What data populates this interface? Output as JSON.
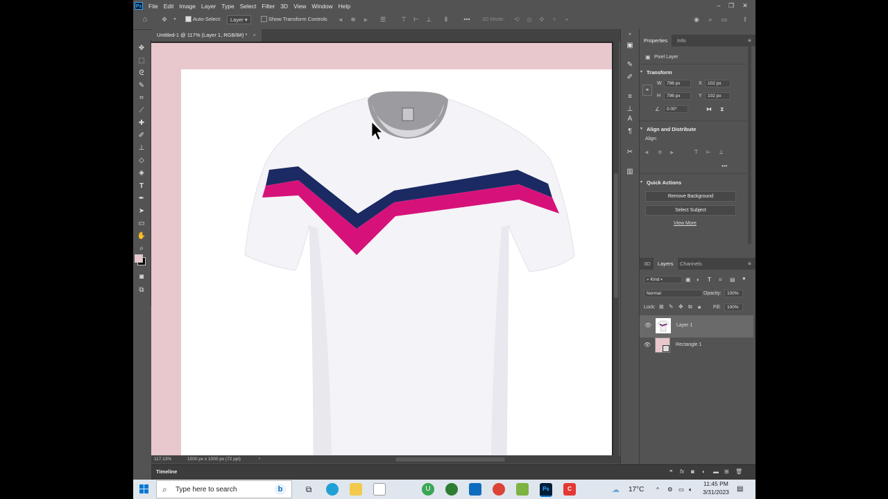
{
  "menu": [
    "File",
    "Edit",
    "Image",
    "Layer",
    "Type",
    "Select",
    "Filter",
    "3D",
    "View",
    "Window",
    "Help"
  ],
  "options_bar": {
    "auto_select_label": "Auto-Select:",
    "auto_select_value": "Layer",
    "show_transform_controls_label": "Show Transform Controls",
    "mode_3d_label": "3D Mode:"
  },
  "document": {
    "tab_title": "Untitled-1 @ 117% (Layer 1, RGB/8#) *",
    "zoom": "117.13%",
    "size_info": "1000 px x 1000 px (72 ppi)"
  },
  "timeline_label": "Timeline",
  "properties": {
    "tabs": [
      "Properties",
      "Info"
    ],
    "layer_type": "Pixel Layer",
    "transform_title": "Transform",
    "w_label": "W",
    "w_value": "796 px",
    "h_label": "H",
    "h_value": "796 px",
    "x_label": "X",
    "x_value": "102 px",
    "y_label": "Y",
    "y_value": "102 px",
    "angle_value": "0.00°",
    "align_title": "Align and Distribute",
    "align_label": "Align:",
    "quick_actions_title": "Quick Actions",
    "remove_bg_label": "Remove Background",
    "select_subject_label": "Select Subject",
    "view_more_label": "View More"
  },
  "layers_panel": {
    "tabs": [
      "3D",
      "Layers",
      "Channels"
    ],
    "kind_label": "Kind",
    "blend_mode": "Normal",
    "opacity_label": "Opacity:",
    "opacity_value": "100%",
    "lock_label": "Lock:",
    "fill_label": "Fill:",
    "fill_value": "100%",
    "layers": [
      {
        "name": "Layer 1",
        "selected": true
      },
      {
        "name": "Rectangle 1",
        "selected": false
      }
    ]
  },
  "taskbar": {
    "search_placeholder": "Type here to search",
    "weather": "17°C",
    "time": "11:45 PM",
    "date": "3/31/2023"
  },
  "colors": {
    "artboard_pink": "#e8c7cd",
    "stripe_navy": "#1b2a63",
    "stripe_magenta": "#d6127a",
    "ps_bg": "#535353"
  }
}
